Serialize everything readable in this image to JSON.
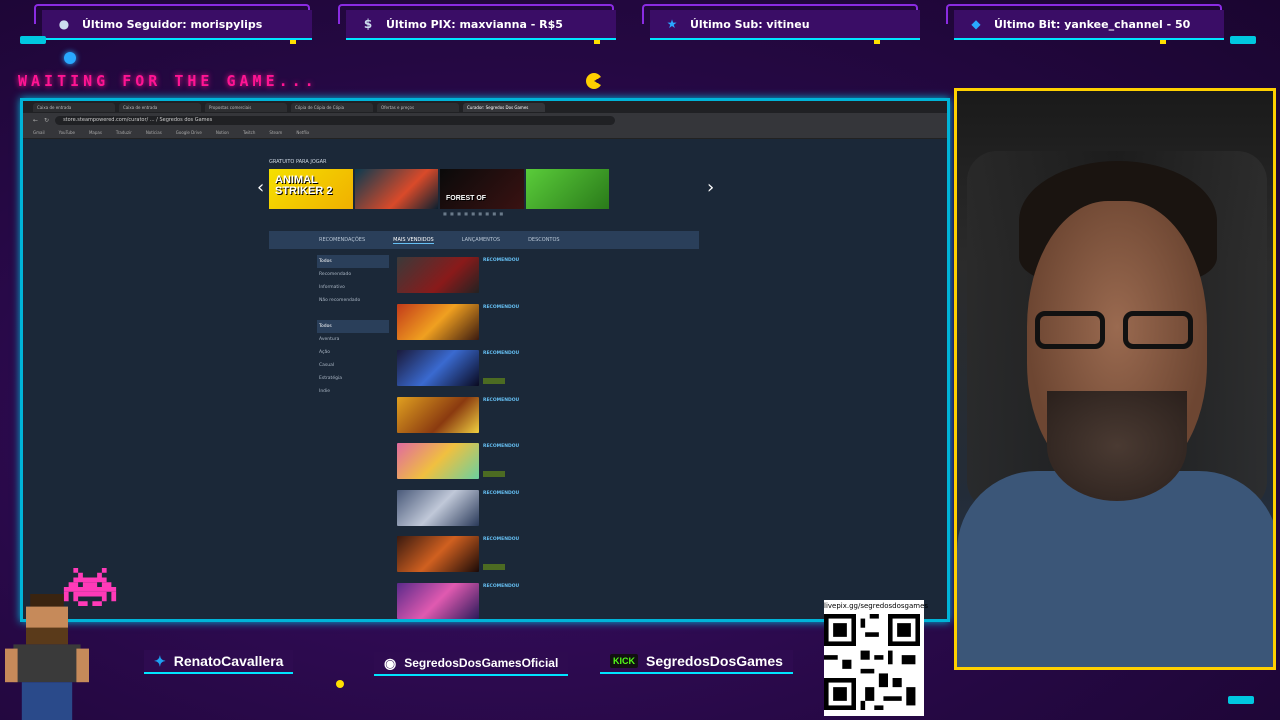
{
  "top_bar": {
    "items": [
      {
        "icon": "user-icon",
        "label": "Último Seguidor: morispylips"
      },
      {
        "icon": "dollar-icon",
        "label": "Último PIX: maxvianna - R$5"
      },
      {
        "icon": "star-icon",
        "label": "Último Sub: vitineu"
      },
      {
        "icon": "diamond-icon",
        "label": "Último Bit: yankee_channel - 50"
      }
    ]
  },
  "overlay": {
    "waiting_text": "WAITING FOR THE GAME..."
  },
  "browser": {
    "tabs": [
      "Caixa de entrada",
      "Caixa de entrada",
      "Propostas comerciais",
      "Cópia de Cópia de Cópia",
      "Ofertas e preços",
      "Curador: Segredos Dos Games"
    ],
    "url": "store.steampowered.com/curator/ ... / Segredos dos Games",
    "bookmarks": [
      "Gmail",
      "YouTube",
      "Mapas",
      "Traduzir",
      "Notícias",
      "Google Drive",
      "Notion",
      "Twitch",
      "Steam",
      "Netflix"
    ]
  },
  "steam": {
    "free_label": "GRATUITO PARA JOGAR",
    "carousel": [
      "ANIMAL STRIKER 2",
      "",
      "FOREST OF",
      ""
    ],
    "tabs": [
      "RECOMENDAÇÕES",
      "MAIS VENDIDOS",
      "LANÇAMENTOS",
      "DESCONTOS"
    ],
    "filters": [
      "Todos",
      "Recomendado",
      "Informativo",
      "Não recomendado",
      "",
      "Todos",
      "Aventura",
      "Ação",
      "Casual",
      "Estratégia",
      "Indie"
    ],
    "review_label": "RECOMENDOU"
  },
  "social": {
    "twitter": "RenatoCavallera",
    "instagram": "SegredosDosGamesOficial",
    "kick_badge": "KICK",
    "kick": "SegredosDosGames",
    "qr_label": "livepix.gg/segredosdosgames"
  }
}
